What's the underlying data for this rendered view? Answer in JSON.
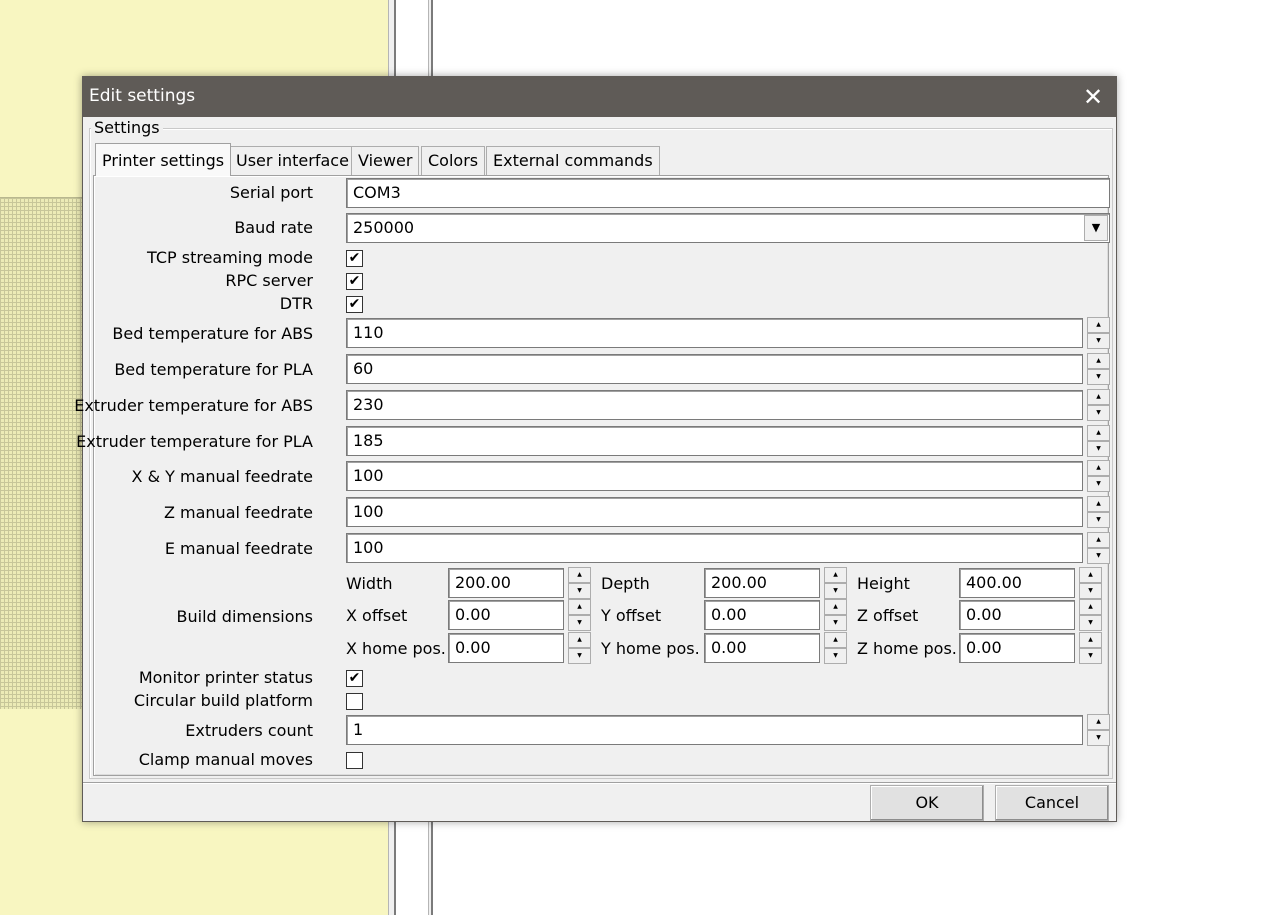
{
  "dialog": {
    "title": "Edit settings",
    "close_glyph": "✕",
    "group_label": "Settings",
    "ok_label": "OK",
    "cancel_label": "Cancel"
  },
  "tabs": [
    {
      "label": "Printer settings",
      "active": true
    },
    {
      "label": "User interface",
      "active": false
    },
    {
      "label": "Viewer",
      "active": false
    },
    {
      "label": "Colors",
      "active": false
    },
    {
      "label": "External commands",
      "active": false
    }
  ],
  "printer": {
    "serial_port": {
      "label": "Serial port",
      "value": "COM3"
    },
    "baud_rate": {
      "label": "Baud rate",
      "value": "250000"
    },
    "tcp_streaming": {
      "label": "TCP streaming mode",
      "checked": true
    },
    "rpc_server": {
      "label": "RPC server",
      "checked": true
    },
    "dtr": {
      "label": "DTR",
      "checked": true
    },
    "bed_abs": {
      "label": "Bed temperature for ABS",
      "value": "110"
    },
    "bed_pla": {
      "label": "Bed temperature for PLA",
      "value": "60"
    },
    "ext_abs": {
      "label": "Extruder temperature for ABS",
      "value": "230"
    },
    "ext_pla": {
      "label": "Extruder temperature for PLA",
      "value": "185"
    },
    "xy_feed": {
      "label": "X & Y manual feedrate",
      "value": "100"
    },
    "z_feed": {
      "label": "Z manual feedrate",
      "value": "100"
    },
    "e_feed": {
      "label": "E manual feedrate",
      "value": "100"
    },
    "build": {
      "label": "Build dimensions",
      "width": {
        "label": "Width",
        "value": "200.00"
      },
      "depth": {
        "label": "Depth",
        "value": "200.00"
      },
      "height": {
        "label": "Height",
        "value": "400.00"
      },
      "x_offset": {
        "label": "X offset",
        "value": "0.00"
      },
      "y_offset": {
        "label": "Y offset",
        "value": "0.00"
      },
      "z_offset": {
        "label": "Z offset",
        "value": "0.00"
      },
      "x_home": {
        "label": "X home pos.",
        "value": "0.00"
      },
      "y_home": {
        "label": "Y home pos.",
        "value": "0.00"
      },
      "z_home": {
        "label": "Z home pos.",
        "value": "0.00"
      }
    },
    "monitor_status": {
      "label": "Monitor printer status",
      "checked": true
    },
    "circular_platform": {
      "label": "Circular build platform",
      "checked": false
    },
    "extruders_count": {
      "label": "Extruders count",
      "value": "1"
    },
    "clamp_moves": {
      "label": "Clamp manual moves",
      "checked": false
    }
  },
  "icons": {
    "check": "✔",
    "dropdown": "▼",
    "spin_up": "▲",
    "spin_down": "▼"
  },
  "colors": {
    "titlebar": "#5f5b57",
    "dialog_bg": "#f0f0f0",
    "app_bg_yellow": "#f8f6c1"
  }
}
